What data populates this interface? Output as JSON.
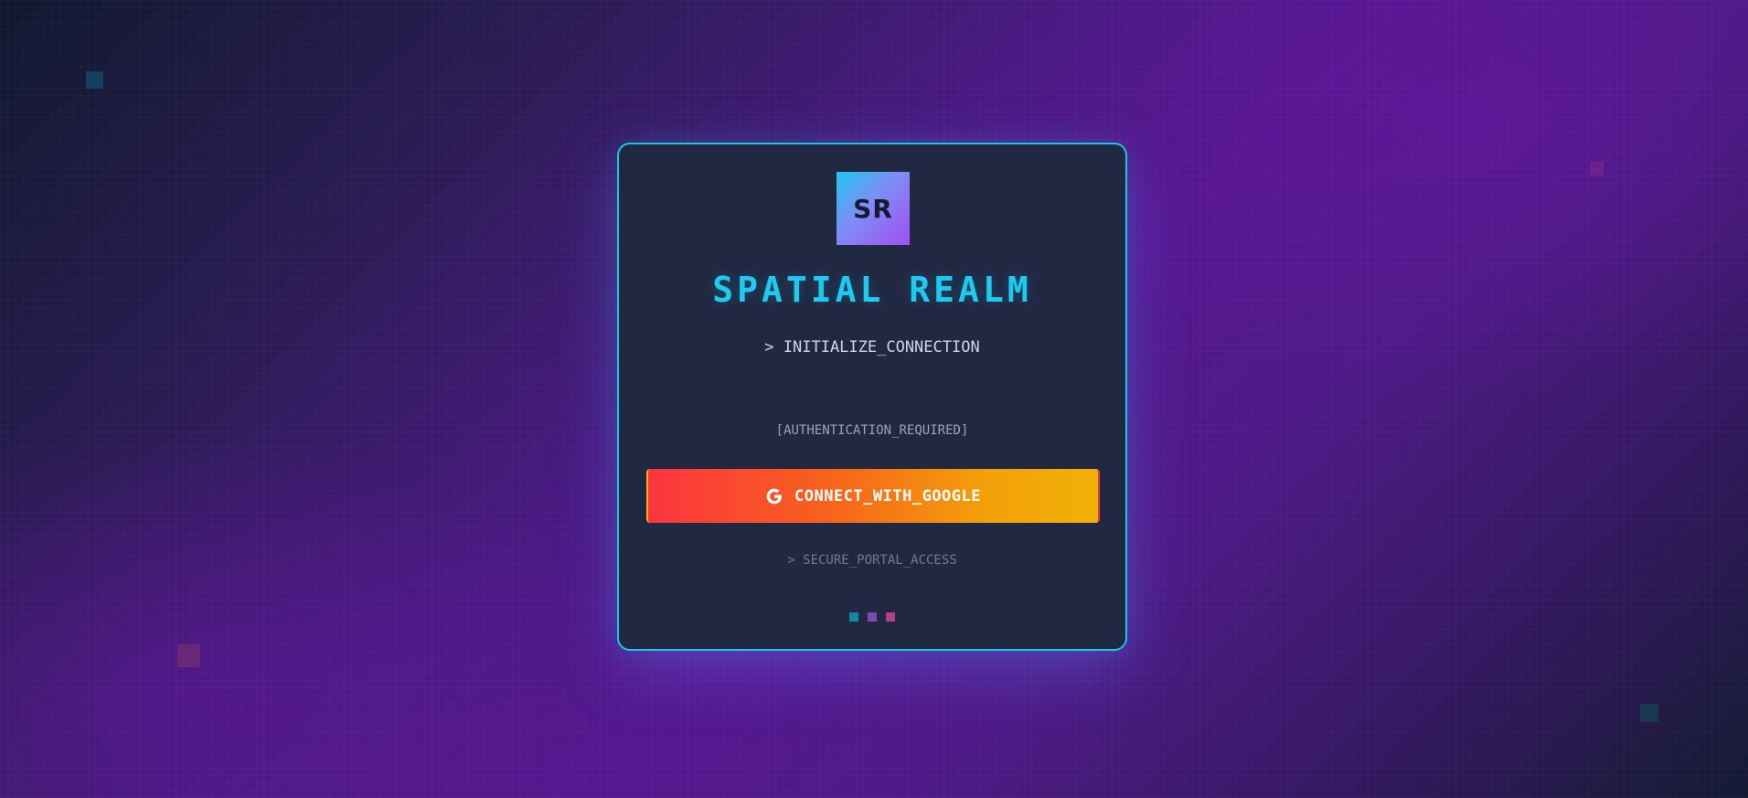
{
  "app": {
    "logo_text": "SR",
    "title": "SPATIAL REALM",
    "subtitle": "> INITIALIZE_CONNECTION"
  },
  "auth": {
    "status_label": "[AUTHENTICATION_REQUIRED]",
    "google_button_label": "CONNECT_WITH_GOOGLE",
    "google_icon": "google-g-icon",
    "secure_note": "> SECURE_PORTAL_ACCESS"
  },
  "indicators": {
    "dot_colors": [
      "#118ba3",
      "#7b4bb2",
      "#b0418a"
    ]
  },
  "theme": {
    "accent": "#1ecbf0",
    "card_background": "#212842",
    "button_gradient_start": "#fc3440",
    "button_gradient_end": "#f0b106"
  }
}
